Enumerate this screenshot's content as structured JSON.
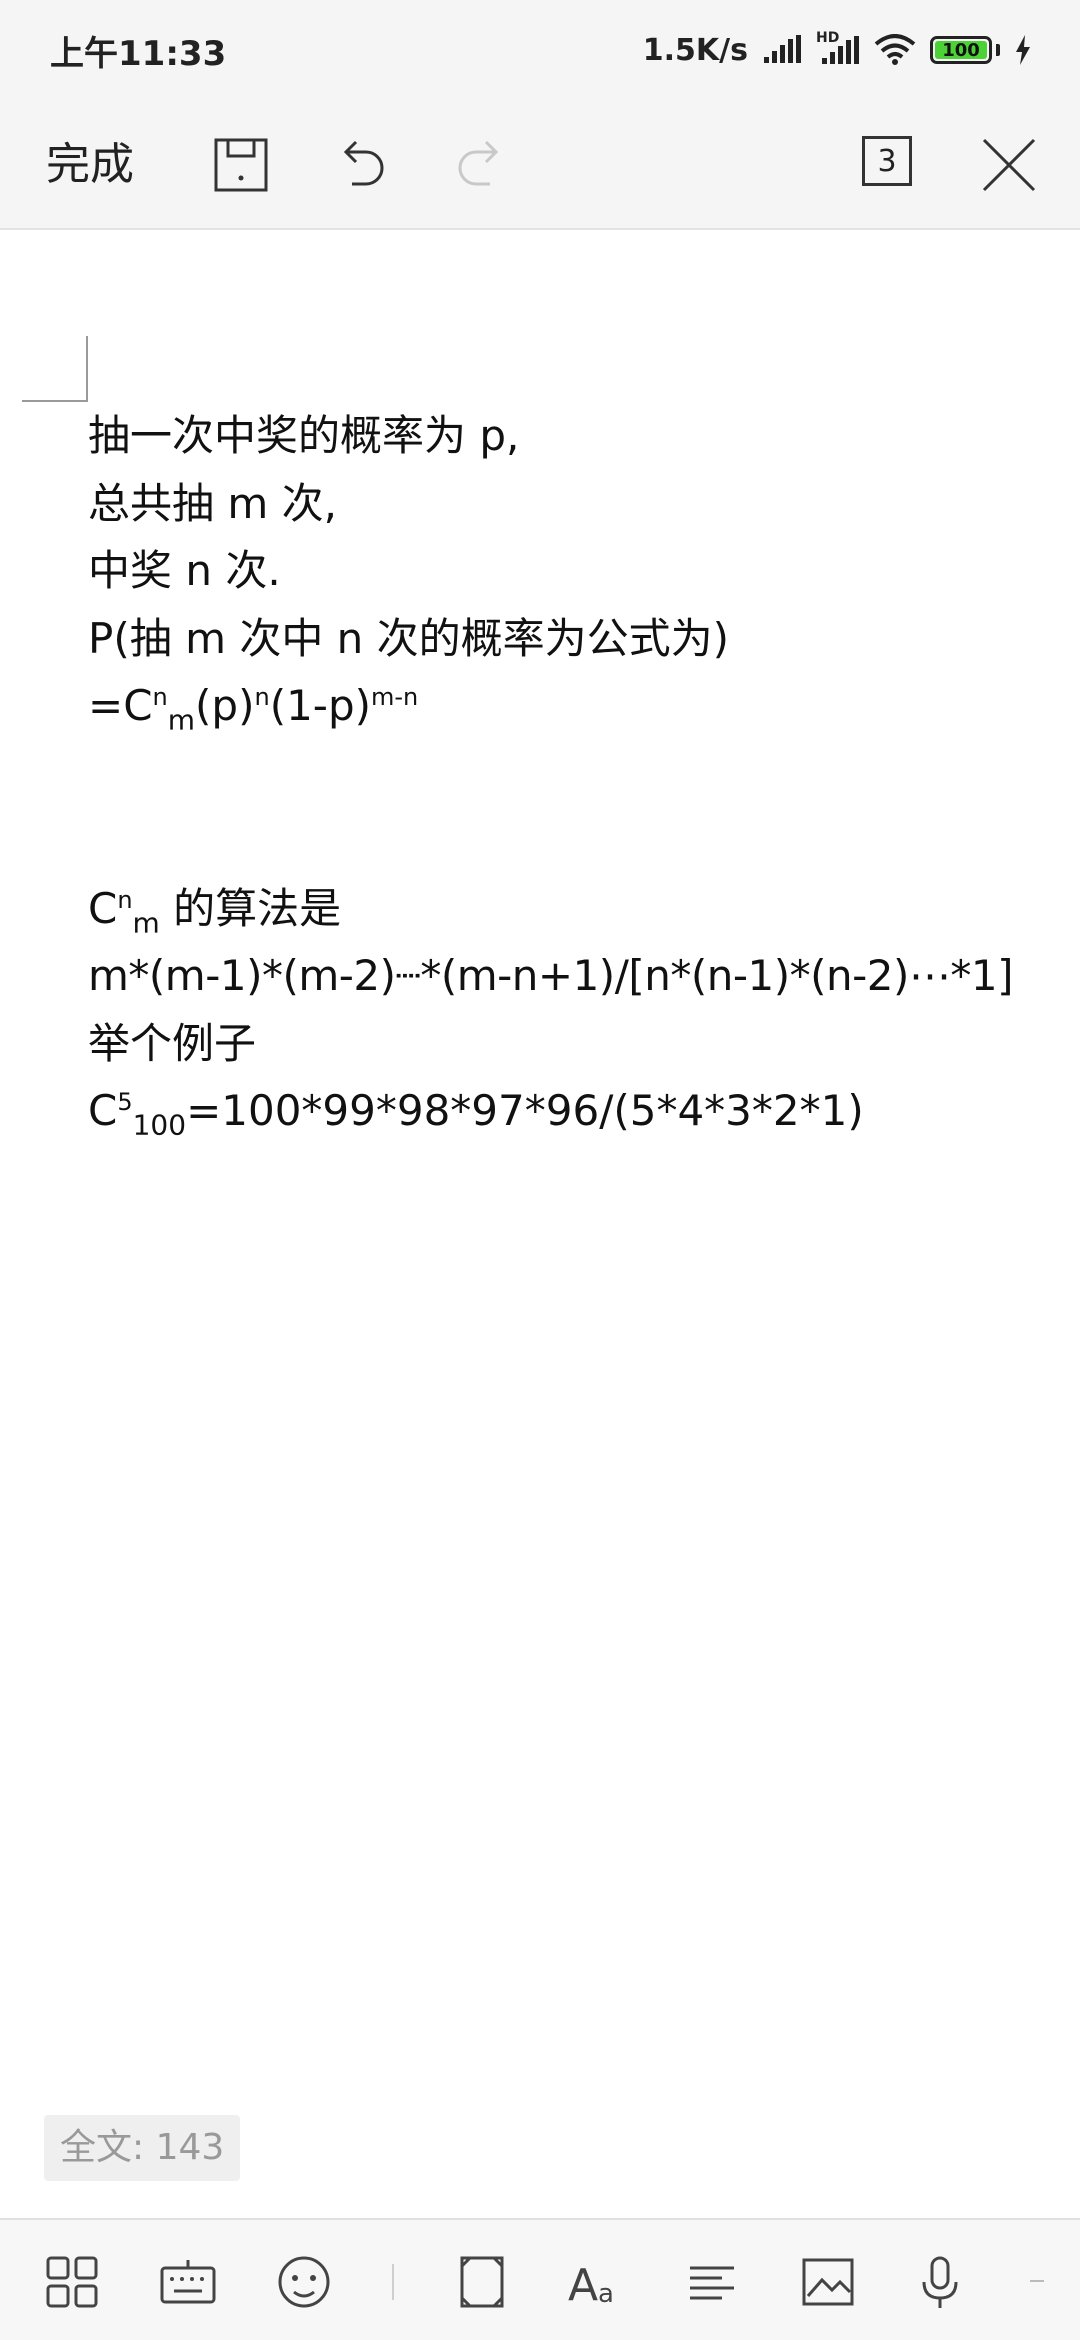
{
  "status_bar": {
    "time": "上午11:33",
    "net_speed": "1.5K/s",
    "hd_badge": "HD",
    "battery_level": "100"
  },
  "toolbar": {
    "done_label": "完成",
    "page_count": "3",
    "icons": [
      "save-icon",
      "undo-icon",
      "redo-icon",
      "close-icon"
    ]
  },
  "document": {
    "line1": "抽一次中奖的概率为 p,",
    "line2": "总共抽 m 次,",
    "line3": "中奖 n 次.",
    "line4": "P(抽 m 次中 n 次的概率为公式为)",
    "line5": {
      "eq": "=C",
      "sup_n": "n",
      "sub_m": "m",
      "mid": "(p)",
      "sup_n2": "n",
      "rest": "(1-p)",
      "sup_mn": "m-n"
    },
    "line6": {
      "c": "C",
      "sup_n": "n",
      "sub_m": "m",
      "rest": " 的算法是"
    },
    "line7": "m*(m-1)*(m-2)┈*(m-n+1)/[n*(n-1)*(n-2)⋯*1]",
    "line8": "举个例子",
    "line9": {
      "c": "C",
      "sup_5": "5",
      "sub_100": "100",
      "rest": "=100*99*98*97*96/(5*4*3*2*1)"
    }
  },
  "word_count": "全文: 143",
  "bottom_bar": {
    "icons": [
      "grid-icon",
      "keyboard-icon",
      "emoji-icon",
      "fullscreen-icon",
      "font-icon",
      "align-icon",
      "image-icon",
      "microphone-icon"
    ]
  },
  "colors": {
    "bar_background": "#f5f5f5",
    "battery_green": "#4cd137",
    "disabled_icon": "#c8c8c8"
  }
}
